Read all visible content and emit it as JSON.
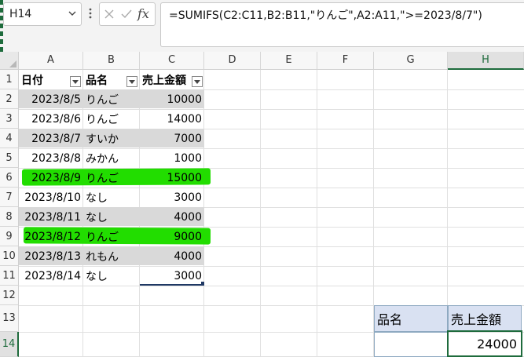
{
  "namebox": {
    "value": "H14"
  },
  "formula_bar": {
    "fx_label": "fx",
    "formula": "=SUMIFS(C2:C11,B2:B11,\"りんご\",A2:A11,\">=2023/8/7\")"
  },
  "columns": [
    "A",
    "B",
    "C",
    "D",
    "E",
    "F",
    "G",
    "H"
  ],
  "rows": [
    "1",
    "2",
    "3",
    "4",
    "5",
    "6",
    "7",
    "8",
    "9",
    "10",
    "11",
    "12",
    "13",
    "14"
  ],
  "table": {
    "headers": [
      "日付",
      "品名",
      "売上金額"
    ],
    "rows": [
      {
        "date": "2023/8/5",
        "item": "りんご",
        "amount": "10000"
      },
      {
        "date": "2023/8/6",
        "item": "りんご",
        "amount": "14000"
      },
      {
        "date": "2023/8/7",
        "item": "すいか",
        "amount": "7000"
      },
      {
        "date": "2023/8/8",
        "item": "みかん",
        "amount": "1000"
      },
      {
        "date": "2023/8/9",
        "item": "りんご",
        "amount": "15000"
      },
      {
        "date": "2023/8/10",
        "item": "なし",
        "amount": "3000"
      },
      {
        "date": "2023/8/11",
        "item": "なし",
        "amount": "4000"
      },
      {
        "date": "2023/8/12",
        "item": "りんご",
        "amount": "9000"
      },
      {
        "date": "2023/8/13",
        "item": "れもん",
        "amount": "4000"
      },
      {
        "date": "2023/8/14",
        "item": "なし",
        "amount": "3000"
      }
    ]
  },
  "result": {
    "header_item": "品名",
    "header_amount": "売上金額",
    "item_value": "",
    "amount_value": "24000"
  },
  "colors": {
    "band": "#d9d9d9",
    "highlight": "#22dd00",
    "result_header": "#d9e1f2",
    "selection": "#1e6b3c"
  }
}
